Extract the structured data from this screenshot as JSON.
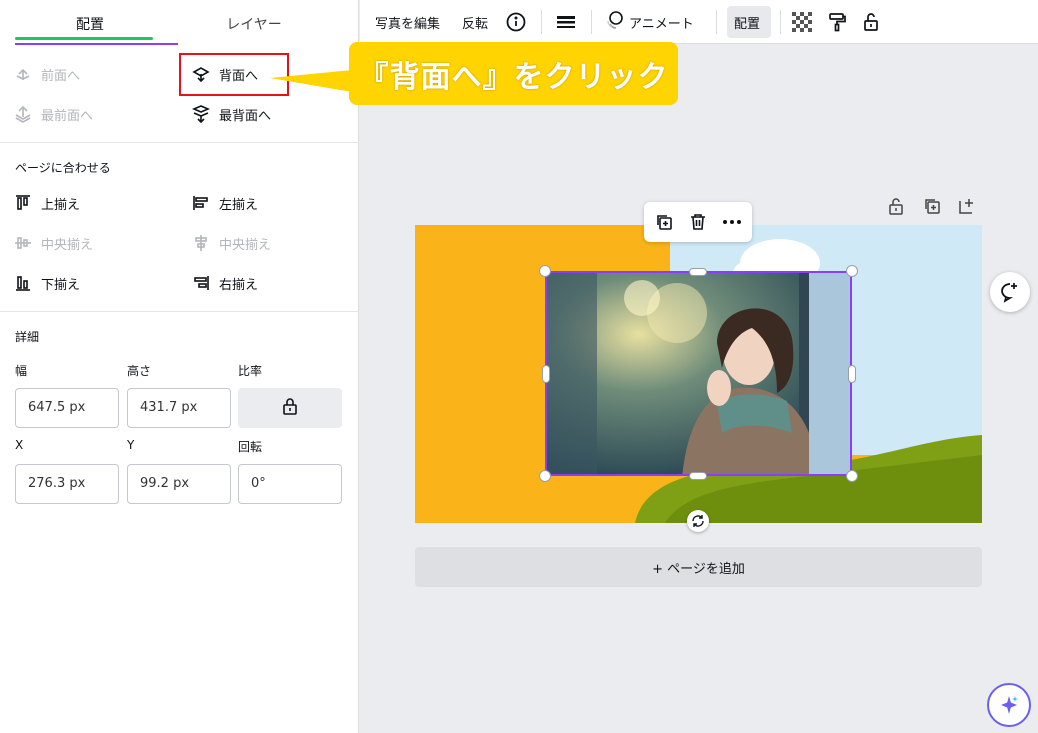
{
  "tabs": {
    "arrange": "配置",
    "layers": "レイヤー"
  },
  "order": {
    "forward": "前面へ",
    "backward": "背面へ",
    "to_front": "最前面へ",
    "to_back": "最背面へ"
  },
  "align": {
    "title": "ページに合わせる",
    "top": "上揃え",
    "left": "左揃え",
    "middle": "中央揃え",
    "center": "中央揃え",
    "bottom": "下揃え",
    "right": "右揃え"
  },
  "details": {
    "title": "詳細",
    "width_label": "幅",
    "height_label": "高さ",
    "ratio_label": "比率",
    "width_value": "647.5 px",
    "height_value": "431.7 px",
    "x_label": "X",
    "y_label": "Y",
    "rotate_label": "回転",
    "x_value": "276.3 px",
    "y_value": "99.2 px",
    "rotate_value": "0°"
  },
  "toolbar": {
    "edit_photo": "写真を編集",
    "flip": "反転",
    "animate": "アニメート",
    "arrange": "配置"
  },
  "callout": {
    "text": "『背面へ』をクリック"
  },
  "canvas": {
    "add_page": "+ ページを追加"
  },
  "colors": {
    "accent": "#8b3dff",
    "canvas_bg": "#fbb31a",
    "callout": "#ffd400",
    "highlight": "#e0151c"
  }
}
